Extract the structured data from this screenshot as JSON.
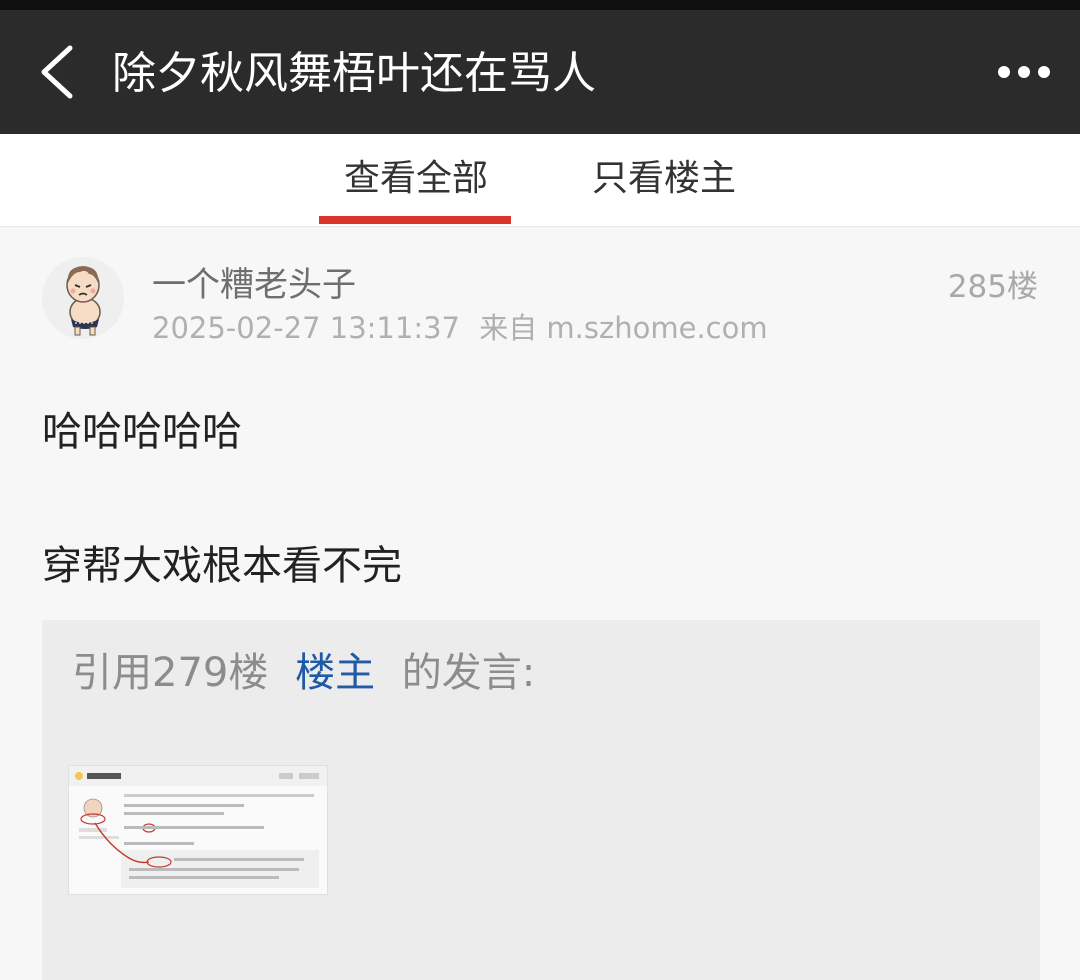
{
  "header": {
    "title": "除夕秋风舞梧叶还在骂人",
    "back_icon": "chevron-left-icon",
    "more_icon": "more-dots-icon"
  },
  "tabs": [
    {
      "label": "查看全部",
      "active": true
    },
    {
      "label": "只看楼主",
      "active": false
    }
  ],
  "post": {
    "username": "一个糟老头子",
    "timestamp": "2025-02-27 13:11:37",
    "source": "来自 m.szhome.com",
    "floor": "285楼",
    "lines": [
      "哈哈哈哈哈",
      "穿帮大戏根本看不完"
    ],
    "quote": {
      "prefix": "引用279楼",
      "author": "楼主",
      "suffix": "的发言:"
    }
  },
  "colors": {
    "header_bg": "#2b2b2b",
    "tab_active_underline": "#d9352b",
    "quote_author": "#1f5aa6"
  }
}
